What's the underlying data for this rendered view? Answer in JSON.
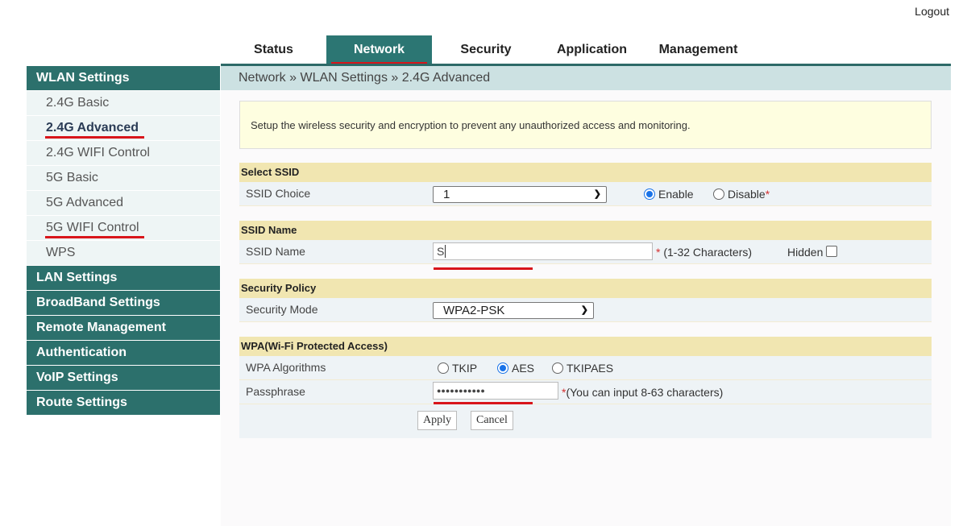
{
  "header": {
    "logout_label": "Logout"
  },
  "topnav": {
    "tabs": [
      {
        "label": "Status",
        "active": false
      },
      {
        "label": "Network",
        "active": true
      },
      {
        "label": "Security",
        "active": false
      },
      {
        "label": "Application",
        "active": false
      },
      {
        "label": "Management",
        "active": false
      }
    ]
  },
  "sidebar": {
    "wlan_header": "WLAN Settings",
    "wlan_items": [
      {
        "label": "2.4G Basic"
      },
      {
        "label": "2.4G Advanced",
        "active": true
      },
      {
        "label": "2.4G WIFI Control"
      },
      {
        "label": "5G Basic"
      },
      {
        "label": "5G Advanced"
      },
      {
        "label": "5G WIFI Control"
      },
      {
        "label": "WPS"
      }
    ],
    "sections": [
      "LAN Settings",
      "BroadBand Settings",
      "Remote Management",
      "Authentication",
      "VoIP Settings",
      "Route Settings"
    ]
  },
  "breadcrumb": "Network » WLAN Settings » 2.4G Advanced",
  "info_text": "Setup the wireless security and encryption to prevent any unauthorized access and monitoring.",
  "form": {
    "select_ssid": {
      "title": "Select SSID",
      "label": "SSID Choice",
      "value": "1",
      "enable_label": "Enable",
      "disable_label": "Disable",
      "selected": "Enable",
      "required_mark": "*"
    },
    "ssid_name": {
      "title": "SSID Name",
      "label": "SSID Name",
      "value": "S",
      "hint": "* (1-32 Characters)",
      "hidden_label": "Hidden",
      "hidden_checked": false
    },
    "security_policy": {
      "title": "Security Policy",
      "label": "Security Mode",
      "value": "WPA2-PSK"
    },
    "wpa": {
      "title": "WPA(Wi-Fi Protected Access)",
      "algorithms_label": "WPA Algorithms",
      "algorithms": [
        "TKIP",
        "AES",
        "TKIPAES"
      ],
      "selected_algorithm": "AES",
      "passphrase_label": "Passphrase",
      "passphrase_masked": "●●●●●●●●●●●",
      "passphrase_hint": "*(You can input 8-63 characters)"
    },
    "apply_label": "Apply",
    "cancel_label": "Cancel"
  },
  "colors": {
    "accent_teal": "#2c706c",
    "highlight_red": "#d8151b",
    "section_header": "#f1e6b1",
    "info_bg": "#fefee0",
    "breadcrumb_bg": "#cce1e2"
  }
}
